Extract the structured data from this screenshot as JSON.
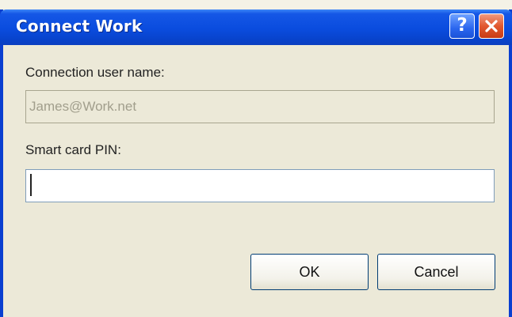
{
  "window": {
    "title": "Connect Work",
    "help_glyph": "?",
    "help_icon": "help-icon",
    "close_icon": "close-icon"
  },
  "form": {
    "user_label": "Connection user name:",
    "user_value": "James@Work.net",
    "pin_label": "Smart card PIN:",
    "pin_value": ""
  },
  "buttons": {
    "ok_label": "OK",
    "cancel_label": "Cancel"
  },
  "colors": {
    "titlebar": "#0a4cde",
    "close_button": "#e2582f",
    "dialog_background": "#ece9d8"
  }
}
